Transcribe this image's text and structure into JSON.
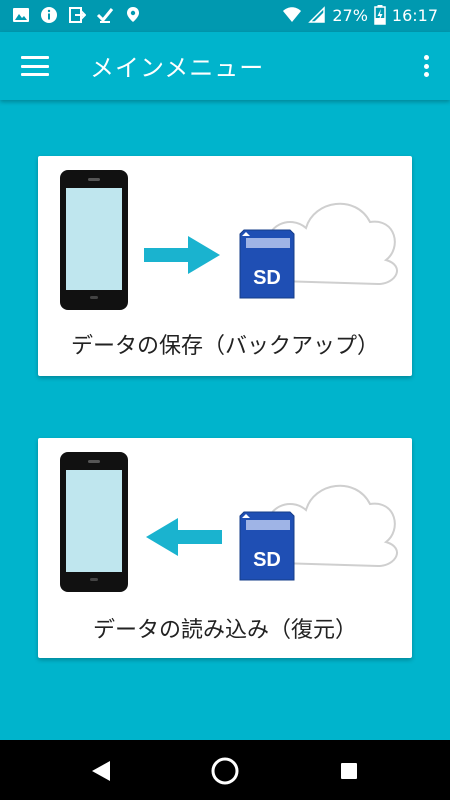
{
  "status_bar": {
    "battery_percent": "27%",
    "time": "16:17"
  },
  "app_bar": {
    "title": "メインメニュー"
  },
  "cards": {
    "backup": {
      "label": "データの保存（バックアップ）",
      "sd_text": "SD"
    },
    "restore": {
      "label": "データの読み込み（復元）",
      "sd_text": "SD"
    }
  },
  "colors": {
    "accent": "#00b4cc",
    "status_bar": "#0099b0",
    "arrow": "#1ab3cf",
    "sd_card": "#1f4fb4"
  }
}
